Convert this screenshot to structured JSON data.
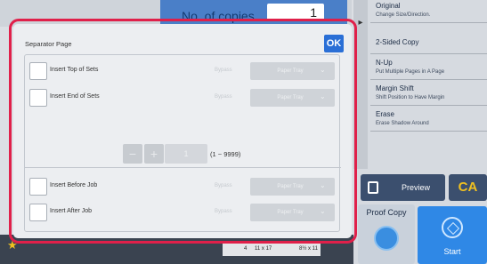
{
  "header": {
    "copies_label": "No. of copies",
    "copies_value": "1"
  },
  "side_menu": {
    "items": [
      {
        "title": "Original",
        "subtitle": "Change Size/Direction."
      },
      {
        "title": "2-Sided Copy",
        "subtitle": ""
      },
      {
        "title": "N-Up",
        "subtitle": "Put Multiple Pages in A Page"
      },
      {
        "title": "Margin Shift",
        "subtitle": "Shift Position to Have Margin"
      },
      {
        "title": "Erase",
        "subtitle": "Erase Shadow Around"
      }
    ]
  },
  "buttons": {
    "preview": "Preview",
    "ca": "CA",
    "proof_copy": "Proof Copy",
    "start": "Start"
  },
  "bottom": {
    "tray_num": "4",
    "tray_size": "11 x 17",
    "tray_size2": "8½ x 11"
  },
  "dialog": {
    "title": "Separator Page",
    "ok": "OK",
    "rows": [
      {
        "label": "Insert Top of Sets",
        "bypass": "Bypass",
        "tray": "Paper Tray"
      },
      {
        "label": "Insert End of Sets",
        "bypass": "Bypass",
        "tray": "Paper Tray"
      },
      {
        "label": "Insert Before Job",
        "bypass": "Bypass",
        "tray": "Paper Tray"
      },
      {
        "label": "Insert After Job",
        "bypass": "Bypass",
        "tray": "Paper Tray"
      }
    ],
    "stepper": {
      "minus": "−",
      "plus": "+",
      "value": "1",
      "range": "(1 ~ 9999)"
    }
  }
}
